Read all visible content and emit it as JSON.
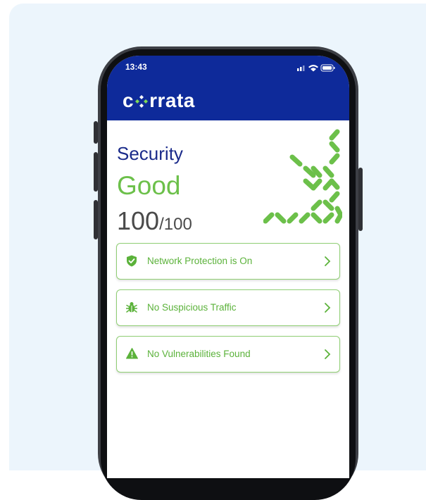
{
  "status_bar": {
    "time": "13:43"
  },
  "app": {
    "brand_prefix": "c",
    "brand_suffix": "rrata"
  },
  "security": {
    "title": "Security",
    "status": "Good",
    "score": "100",
    "score_max": "/100"
  },
  "items": [
    {
      "label": "Network Protection is On",
      "icon": "shield-check-icon"
    },
    {
      "label": "No Suspicious Traffic",
      "icon": "bug-icon"
    },
    {
      "label": "No Vulnerabilities Found",
      "icon": "warning-icon"
    }
  ],
  "colors": {
    "header": "#0e2a9a",
    "accent_green": "#6cc04a",
    "title_blue": "#1a2a8a",
    "background": "#ecf5fc"
  }
}
